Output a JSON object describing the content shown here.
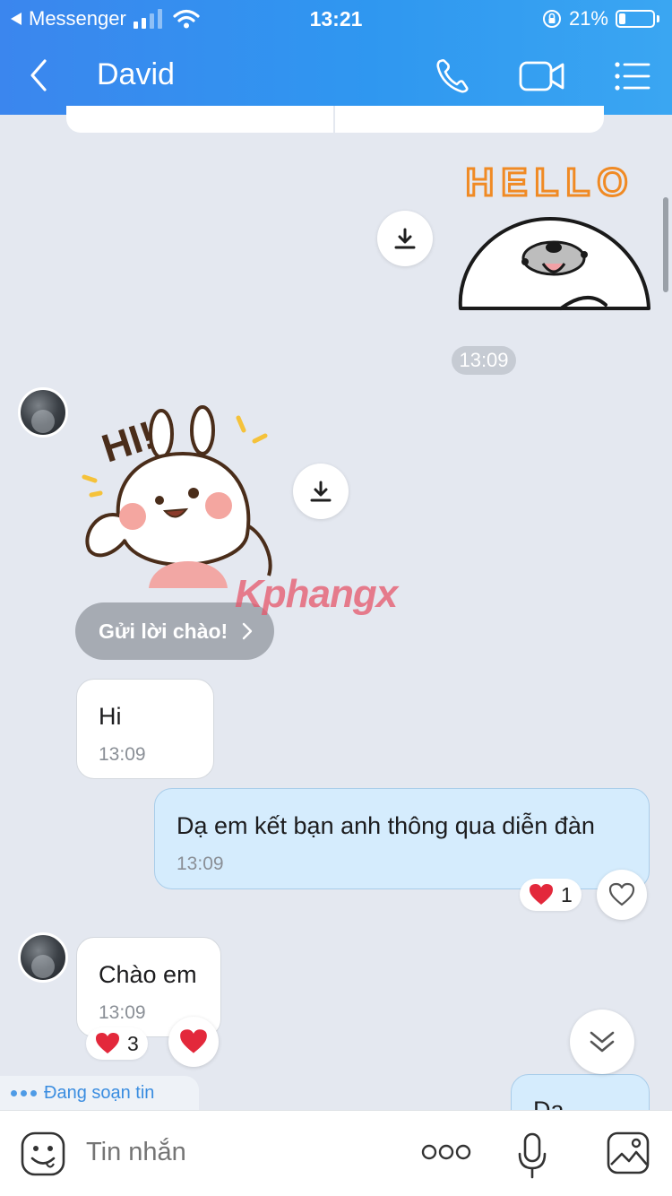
{
  "status_bar": {
    "back_app": "Messenger",
    "time": "13:21",
    "battery": "21%"
  },
  "header": {
    "title": "David"
  },
  "messages": {
    "sticker_time": "13:09",
    "greet_button": "Gửi lời chào!",
    "hi": {
      "text": "Hi",
      "time": "13:09"
    },
    "intro": {
      "text": "Dạ em kết bạn anh thông qua diễn đàn",
      "time": "13:09",
      "reaction_count": "1"
    },
    "hello": {
      "text": "Chào em",
      "time": "13:09",
      "reaction_count": "3"
    },
    "partial": {
      "text": "Da"
    }
  },
  "stickers": {
    "hello_text": "HELLO",
    "hi_text": "HI!"
  },
  "typing_indicator": "Đang soạn tin",
  "watermark": "Kphangx",
  "composer": {
    "placeholder": "Tin nhắn"
  },
  "colors": {
    "header_gradient_start": "#3b86ee",
    "header_gradient_end": "#3aa6f2",
    "background": "#e4e8f0",
    "outgoing_bubble": "#d5ecfd",
    "reaction_heart": "#e3283b"
  }
}
